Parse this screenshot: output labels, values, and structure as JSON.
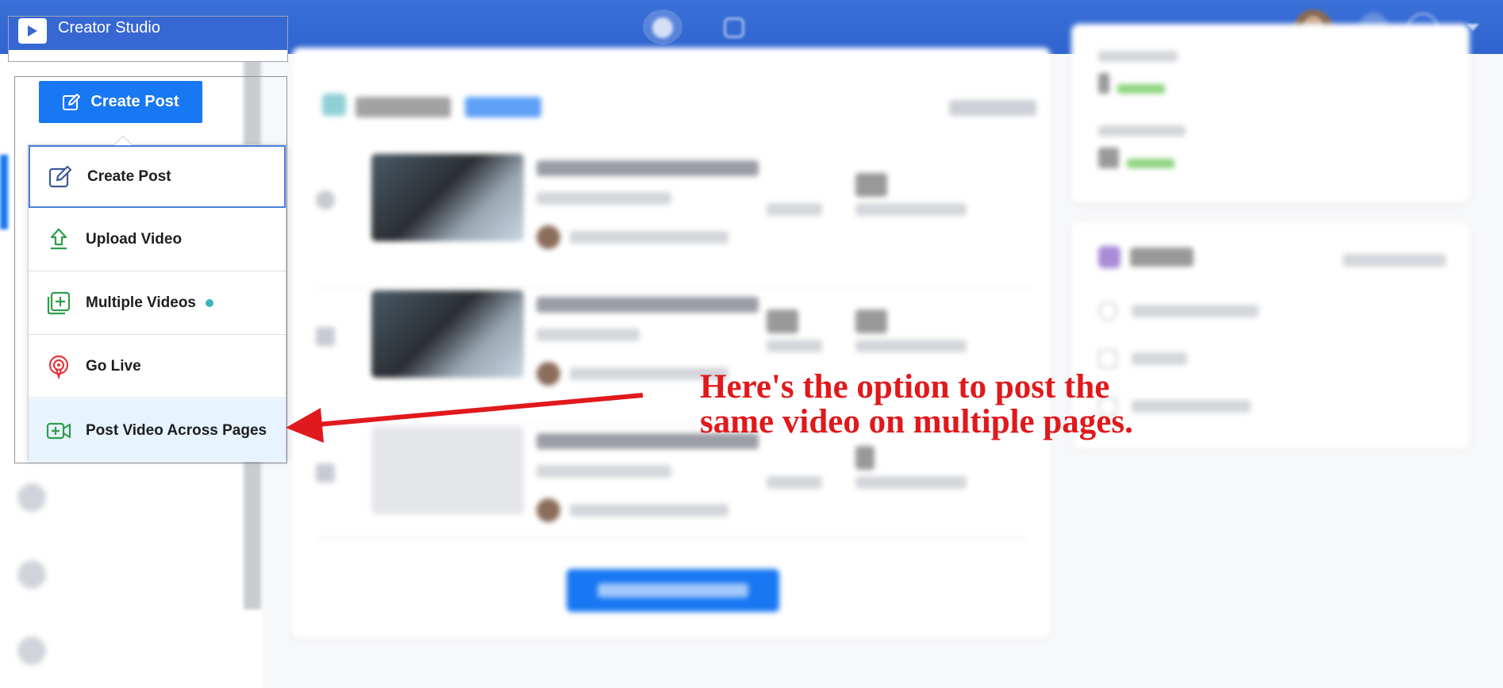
{
  "app": {
    "title": "Creator Studio"
  },
  "create_post_button": {
    "label": "Create Post"
  },
  "dropdown": {
    "items": [
      {
        "label": "Create Post",
        "icon": "edit-icon"
      },
      {
        "label": "Upload Video",
        "icon": "upload-icon"
      },
      {
        "label": "Multiple Videos",
        "icon": "multiple-videos-icon",
        "badge": "new-dot"
      },
      {
        "label": "Go Live",
        "icon": "live-icon"
      },
      {
        "label": "Post Video Across Pages",
        "icon": "video-cross-post-icon"
      }
    ]
  },
  "annotation": {
    "line1": "Here's the option to post the",
    "line2": "same video on multiple pages."
  },
  "colors": {
    "topbar": "#2f64d0",
    "accent": "#1877f2",
    "annotation": "#e0191c",
    "hover_item": "#e7f3ff"
  }
}
